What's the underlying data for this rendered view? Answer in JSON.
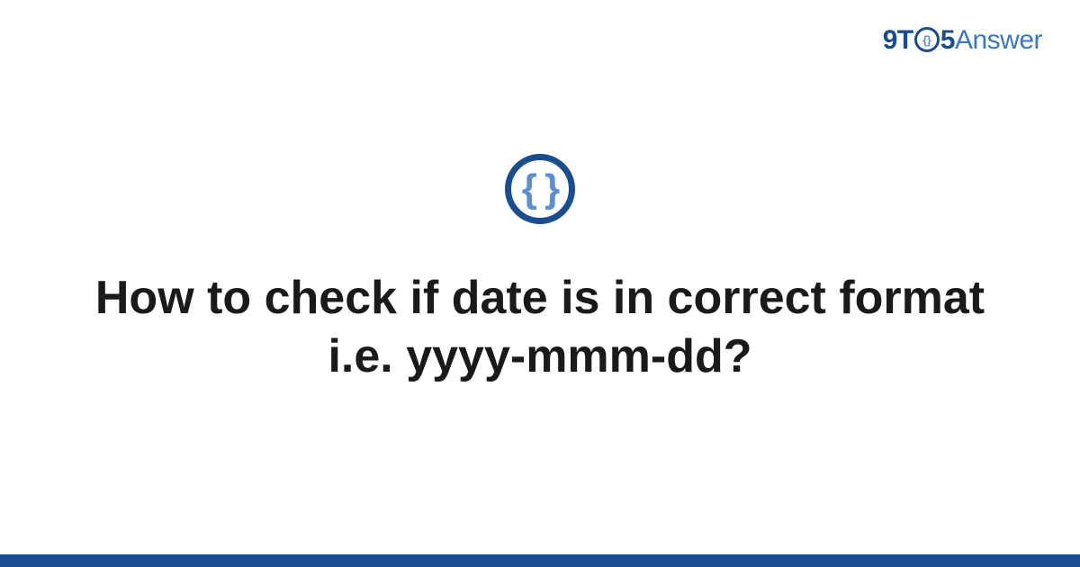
{
  "logo": {
    "part1": "9T",
    "circle_inner": "{}",
    "part2": "5",
    "part3": "Answer"
  },
  "icon": {
    "braces": "{ }"
  },
  "title": "How to check if date is in correct format i.e. yyyy-mmm-dd?",
  "colors": {
    "primary": "#1a4d8f",
    "secondary": "#5a8fd6",
    "text": "#1a1a1a"
  }
}
